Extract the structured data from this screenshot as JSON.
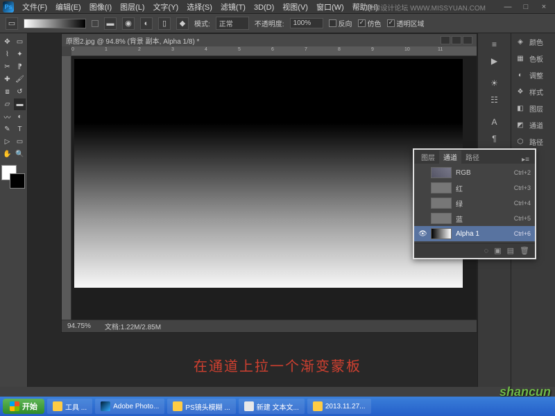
{
  "app": {
    "logo": "Ps"
  },
  "menu": [
    "文件(F)",
    "编辑(E)",
    "图像(I)",
    "图层(L)",
    "文字(Y)",
    "选择(S)",
    "滤镜(T)",
    "3D(D)",
    "视图(V)",
    "窗口(W)",
    "帮助(H)"
  ],
  "watermark": "思缘设计论坛  WWW.MISSYUAN.COM",
  "options": {
    "mode_label": "模式:",
    "mode_value": "正常",
    "opacity_label": "不透明度:",
    "opacity_value": "100%",
    "chk_reverse": "反向",
    "chk_dither": "仿色",
    "chk_trans": "透明区域"
  },
  "doc": {
    "title": "原图2.jpg @ 94.8% (背景 副本, Alpha 1/8) *",
    "zoom": "94.75%",
    "status": "文档:1.22M/2.85M",
    "ruler": [
      "0",
      "1",
      "2",
      "3",
      "4",
      "5",
      "6",
      "7",
      "8",
      "9",
      "10",
      "11"
    ]
  },
  "channels": {
    "tabs": [
      "图层",
      "通道",
      "路径"
    ],
    "active_tab": 1,
    "rows": [
      {
        "name": "RGB",
        "short": "Ctrl+2",
        "thumb": "rgb"
      },
      {
        "name": "红",
        "short": "Ctrl+3",
        "thumb": "gray"
      },
      {
        "name": "绿",
        "short": "Ctrl+4",
        "thumb": "gray"
      },
      {
        "name": "蓝",
        "short": "Ctrl+5",
        "thumb": "gray"
      },
      {
        "name": "Alpha 1",
        "short": "Ctrl+6",
        "thumb": "grad",
        "selected": true,
        "eye": true
      }
    ]
  },
  "side_panels": [
    "颜色",
    "色板",
    "调整",
    "样式",
    "图层",
    "通道",
    "路径"
  ],
  "caption": "在通道上拉一个渐变蒙板",
  "taskbar": {
    "start": "开始",
    "items": [
      {
        "label": "工具 ...",
        "cls": ""
      },
      {
        "label": "Adobe Photo...",
        "cls": "ps"
      },
      {
        "label": "PS镜头模糊 ...",
        "cls": ""
      },
      {
        "label": "新建 文本文...",
        "cls": "txt"
      },
      {
        "label": "2013.11.27...",
        "cls": ""
      }
    ]
  },
  "brand": "shancun"
}
